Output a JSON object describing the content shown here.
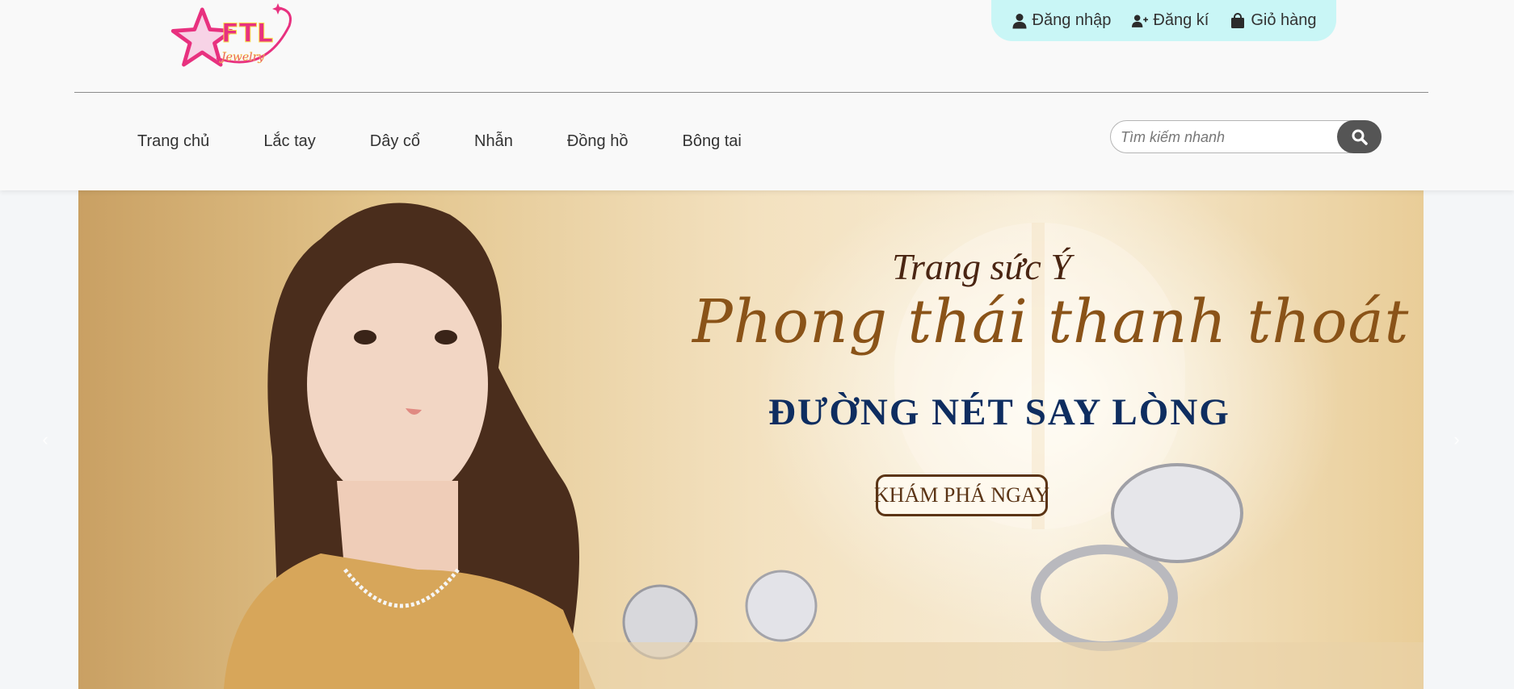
{
  "brand": {
    "logo_main": "FTL",
    "logo_sub": "Jewelry",
    "logo_color": "#e8317f"
  },
  "user_bar": {
    "login": "Đăng nhập",
    "register": "Đăng kí",
    "cart": "Giỏ hàng"
  },
  "nav": {
    "items": [
      "Trang chủ",
      "Lắc tay",
      "Dây cổ",
      "Nhẫn",
      "Đồng hồ",
      "Bông tai"
    ]
  },
  "search": {
    "placeholder": "Tìm kiếm nhanh",
    "button_icon": "search-icon"
  },
  "banner": {
    "line1": "Trang sức Ý",
    "line2": "Phong thái thanh thoát",
    "line3": "ĐƯỜNG NÉT SAY LÒNG",
    "cta": "KHÁM PHÁ NGAY"
  },
  "carousel": {
    "prev_icon": "chevron-left-icon",
    "next_icon": "chevron-right-icon"
  },
  "colors": {
    "user_bar_bg": "#c9f6f6",
    "search_button": "#555555",
    "headline_blue": "#0e2d60"
  }
}
